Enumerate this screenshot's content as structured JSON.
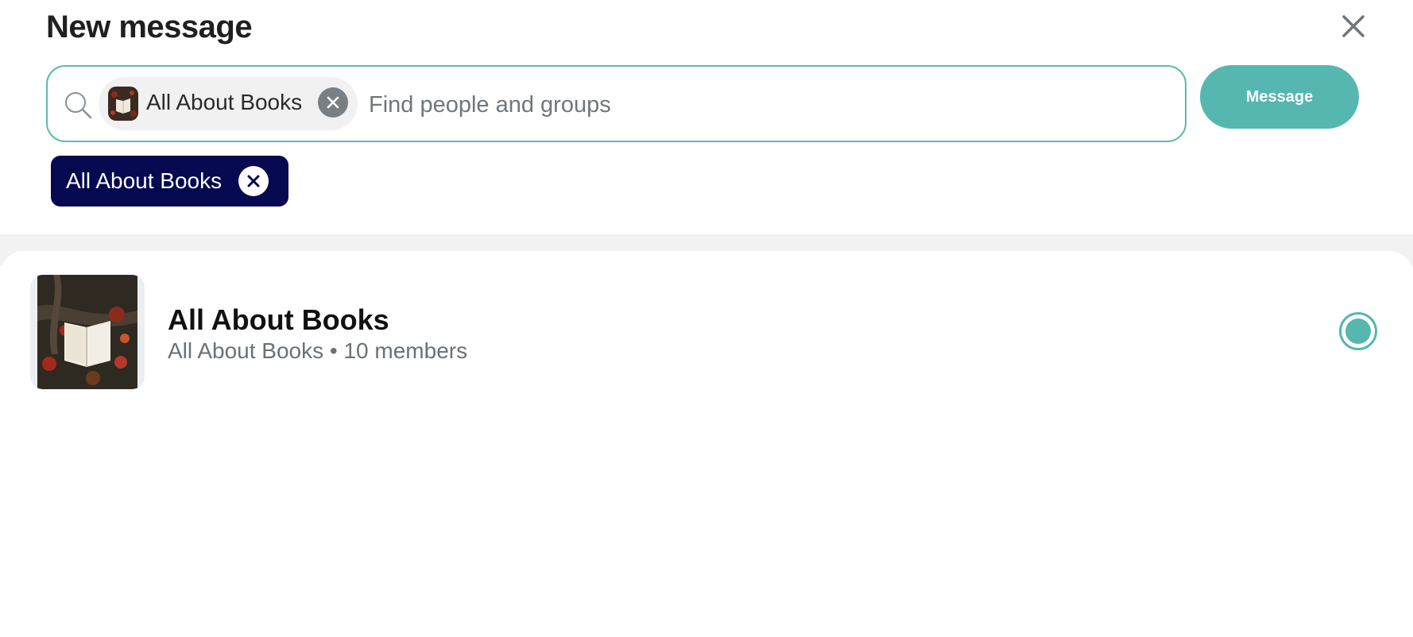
{
  "dialog": {
    "title": "New message",
    "close_icon": "close-icon"
  },
  "search": {
    "icon": "search-icon",
    "placeholder": "Find people and groups",
    "value": "",
    "chips": [
      {
        "label": "All About Books",
        "avatar": "book-on-leaves-image",
        "remove_icon": "close-icon"
      }
    ]
  },
  "actions": {
    "message_label": "Message"
  },
  "selected": {
    "tags": [
      {
        "label": "All About Books",
        "remove_icon": "close-icon"
      }
    ]
  },
  "results": [
    {
      "name": "All About Books",
      "meta": "All About Books • 10 members",
      "thumbnail": "book-on-leaves-image",
      "selected": true
    }
  ],
  "colors": {
    "accent": "#56b7b0",
    "tag_background": "#060850",
    "text_primary": "#1f1f1f",
    "text_secondary": "#6a7076"
  }
}
